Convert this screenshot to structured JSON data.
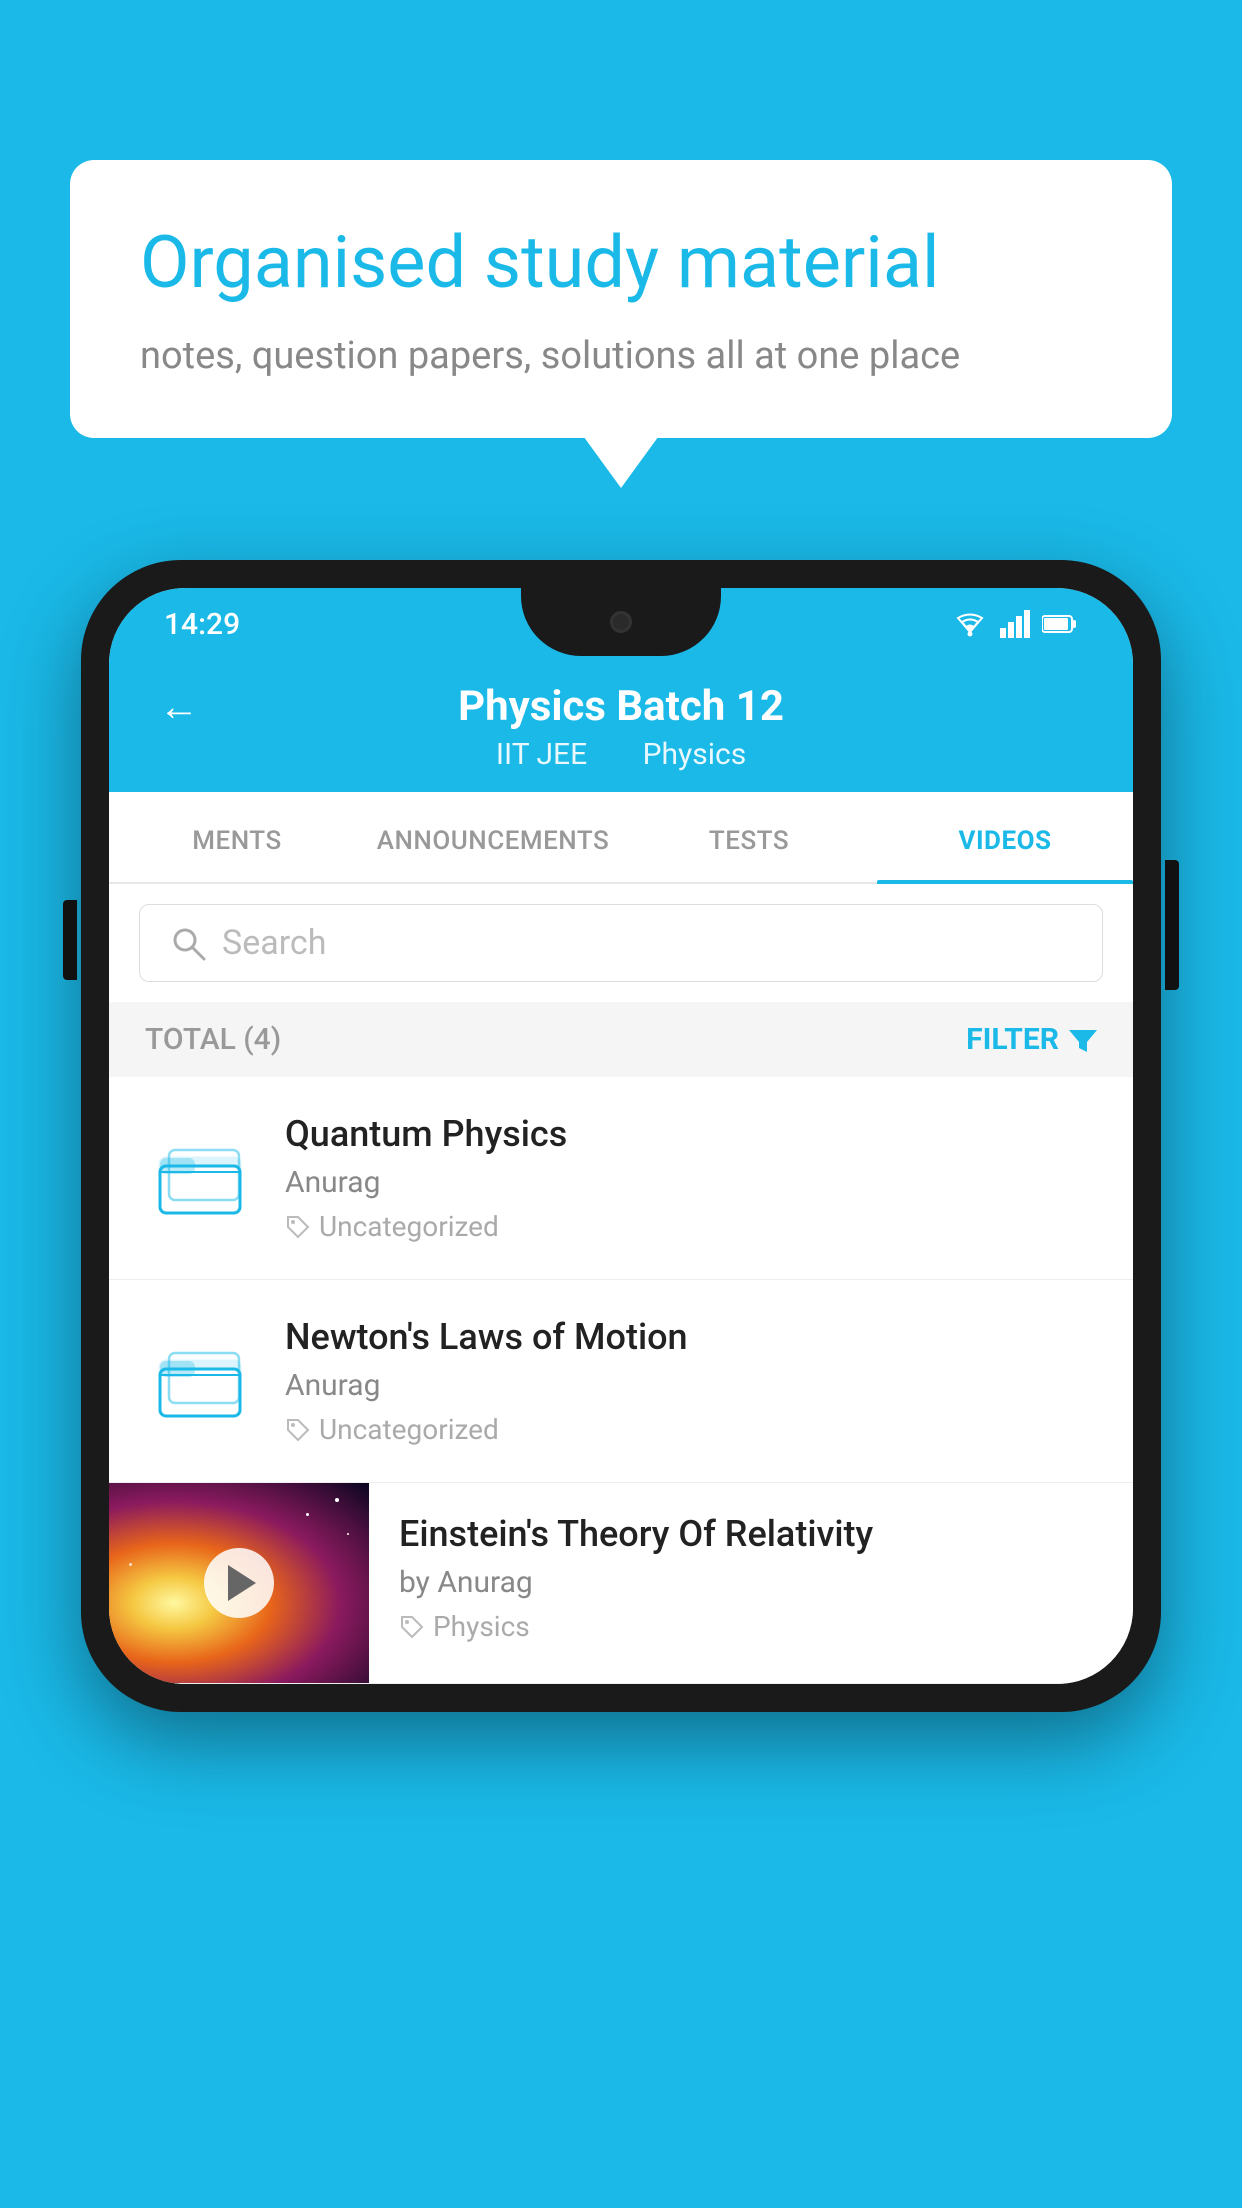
{
  "background_color": "#1ab9e8",
  "speech_bubble": {
    "title": "Organised study material",
    "subtitle": "notes, question papers, solutions all at one place"
  },
  "phone": {
    "status_bar": {
      "time": "14:29",
      "icons": [
        "wifi",
        "signal",
        "battery"
      ]
    },
    "header": {
      "back_label": "←",
      "title": "Physics Batch 12",
      "subtitle_part1": "IIT JEE",
      "subtitle_part2": "Physics"
    },
    "tabs": [
      {
        "label": "MENTS",
        "active": false
      },
      {
        "label": "ANNOUNCEMENTS",
        "active": false
      },
      {
        "label": "TESTS",
        "active": false
      },
      {
        "label": "VIDEOS",
        "active": true
      }
    ],
    "search": {
      "placeholder": "Search"
    },
    "filter_bar": {
      "total_label": "TOTAL (4)",
      "filter_label": "FILTER"
    },
    "videos": [
      {
        "id": 1,
        "title": "Quantum Physics",
        "author": "Anurag",
        "tag": "Uncategorized",
        "has_thumbnail": false
      },
      {
        "id": 2,
        "title": "Newton's Laws of Motion",
        "author": "Anurag",
        "tag": "Uncategorized",
        "has_thumbnail": false
      },
      {
        "id": 3,
        "title": "Einstein's Theory Of Relativity",
        "author": "by Anurag",
        "tag": "Physics",
        "has_thumbnail": true
      }
    ]
  }
}
